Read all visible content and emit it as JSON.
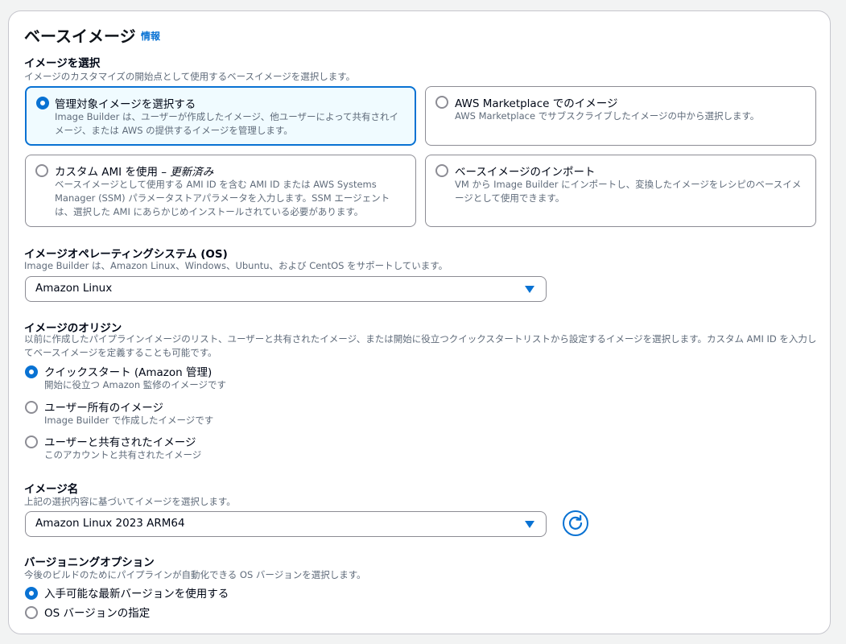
{
  "section": {
    "title": "ベースイメージ",
    "info_link": "情報"
  },
  "select_image": {
    "label": "イメージを選択",
    "description": "イメージのカスタマイズの開始点として使用するベースイメージを選択します。",
    "tiles": [
      {
        "title": "管理対象イメージを選択する",
        "title_suffix": "",
        "description": "Image Builder は、ユーザーが作成したイメージ、他ユーザーによって共有されイメージ、または AWS の提供するイメージを管理します。",
        "selected": true
      },
      {
        "title": "AWS Marketplace でのイメージ",
        "title_suffix": "",
        "description": "AWS Marketplace でサブスクライブしたイメージの中から選択します。",
        "selected": false
      },
      {
        "title": "カスタム AMI を使用 – ",
        "title_suffix": "更新済み",
        "description": "ベースイメージとして使用する AMI ID を含む AMI ID または AWS Systems Manager (SSM) パラメータストアパラメータを入力します。SSM エージェントは、選択した AMI にあらかじめインストールされている必要があります。",
        "selected": false
      },
      {
        "title": "ベースイメージのインポート",
        "title_suffix": "",
        "description": "VM から Image Builder にインポートし、変換したイメージをレシピのベースイメージとして使用できます。",
        "selected": false
      }
    ]
  },
  "os": {
    "label": "イメージオペレーティングシステム (OS)",
    "description": "Image Builder は、Amazon Linux、Windows、Ubuntu、および CentOS をサポートしています。",
    "selected": "Amazon Linux"
  },
  "origin": {
    "label": "イメージのオリジン",
    "description": "以前に作成したパイプラインイメージのリスト、ユーザーと共有されたイメージ、または開始に役立つクイックスタートリストから設定するイメージを選択します。カスタム AMI ID を入力してベースイメージを定義することも可能です。",
    "options": [
      {
        "label": "クイックスタート (Amazon 管理)",
        "description": "開始に役立つ Amazon 監修のイメージです",
        "selected": true
      },
      {
        "label": "ユーザー所有のイメージ",
        "description": "Image Builder で作成したイメージです",
        "selected": false
      },
      {
        "label": "ユーザーと共有されたイメージ",
        "description": "このアカウントと共有されたイメージ",
        "selected": false
      }
    ]
  },
  "image_name": {
    "label": "イメージ名",
    "description": "上記の選択内容に基づいてイメージを選択します。",
    "selected": "Amazon Linux 2023 ARM64",
    "refresh_icon": "refresh-icon"
  },
  "versioning": {
    "label": "バージョニングオプション",
    "description": "今後のビルドのためにパイプラインが自動化できる OS バージョンを選択します。",
    "options": [
      {
        "label": "入手可能な最新バージョンを使用する",
        "selected": true
      },
      {
        "label": "OS バージョンの指定",
        "selected": false
      }
    ]
  },
  "colors": {
    "accent": "#0972d3",
    "selected_tile_bg": "#f0fbff",
    "border": "#8c8c94",
    "muted_text": "#5f6b7a"
  }
}
